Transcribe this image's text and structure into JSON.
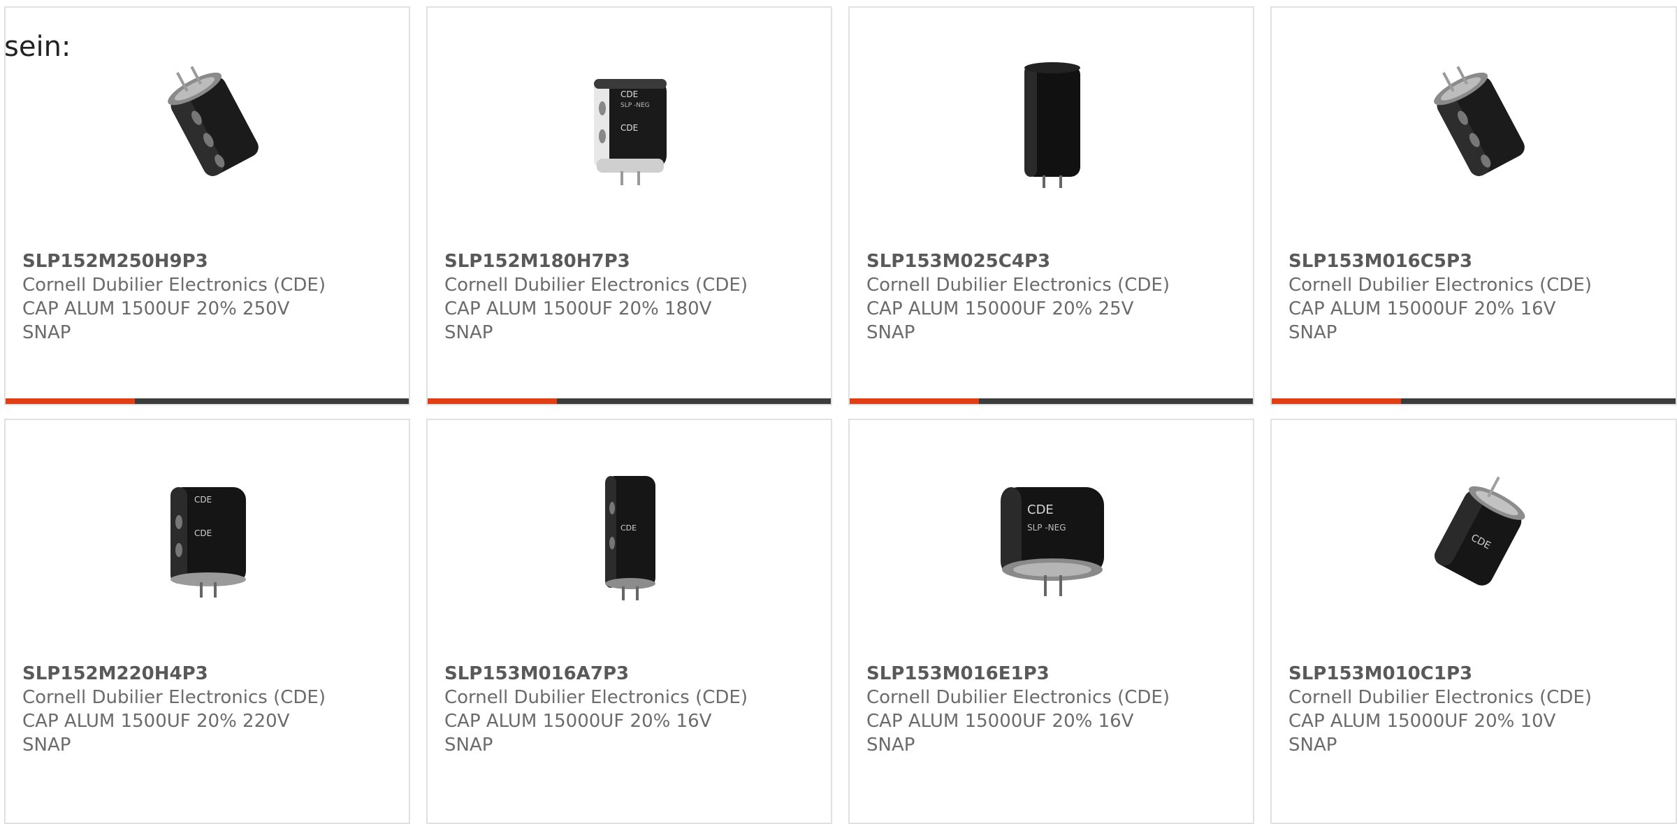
{
  "intro_text": "sein:",
  "colors": {
    "accent_orange": "#e23e14",
    "track_dark": "#3c3c3c",
    "card_border": "#e1e1e1",
    "part_number": "#595959",
    "text_secondary": "#6b6b6b"
  },
  "products": [
    {
      "part_number": "SLP152M250H9P3",
      "manufacturer": "Cornell Dubilier Electronics (CDE)",
      "description_line1": "CAP ALUM 1500UF 20% 250V",
      "description_line2": "SNAP",
      "image_icon": "capacitor-tilted-image",
      "bar_fill": 0.32
    },
    {
      "part_number": "SLP152M180H7P3",
      "manufacturer": "Cornell Dubilier Electronics (CDE)",
      "description_line1": "CAP ALUM 1500UF 20% 180V",
      "description_line2": "SNAP",
      "image_icon": "capacitor-upright-image",
      "bar_fill": 0.32
    },
    {
      "part_number": "SLP153M025C4P3",
      "manufacturer": "Cornell Dubilier Electronics (CDE)",
      "description_line1": "CAP ALUM 15000UF 20% 25V",
      "description_line2": "SNAP",
      "image_icon": "capacitor-tall-image",
      "bar_fill": 0.32
    },
    {
      "part_number": "SLP153M016C5P3",
      "manufacturer": "Cornell Dubilier Electronics (CDE)",
      "description_line1": "CAP ALUM 15000UF 20% 16V",
      "description_line2": "SNAP",
      "image_icon": "capacitor-tilted-image",
      "bar_fill": 0.32
    },
    {
      "part_number": "SLP152M220H4P3",
      "manufacturer": "Cornell Dubilier Electronics (CDE)",
      "description_line1": "CAP ALUM 1500UF 20% 220V",
      "description_line2": "SNAP",
      "image_icon": "capacitor-upright-image"
    },
    {
      "part_number": "SLP153M016A7P3",
      "manufacturer": "Cornell Dubilier Electronics (CDE)",
      "description_line1": "CAP ALUM 15000UF 20% 16V",
      "description_line2": "SNAP",
      "image_icon": "capacitor-tall-image"
    },
    {
      "part_number": "SLP153M016E1P3",
      "manufacturer": "Cornell Dubilier Electronics (CDE)",
      "description_line1": "CAP ALUM 15000UF 20% 16V",
      "description_line2": "SNAP",
      "image_icon": "capacitor-wide-image"
    },
    {
      "part_number": "SLP153M010C1P3",
      "manufacturer": "Cornell Dubilier Electronics (CDE)",
      "description_line1": "CAP ALUM 15000UF 20% 10V",
      "description_line2": "SNAP",
      "image_icon": "capacitor-tilted-image"
    }
  ]
}
